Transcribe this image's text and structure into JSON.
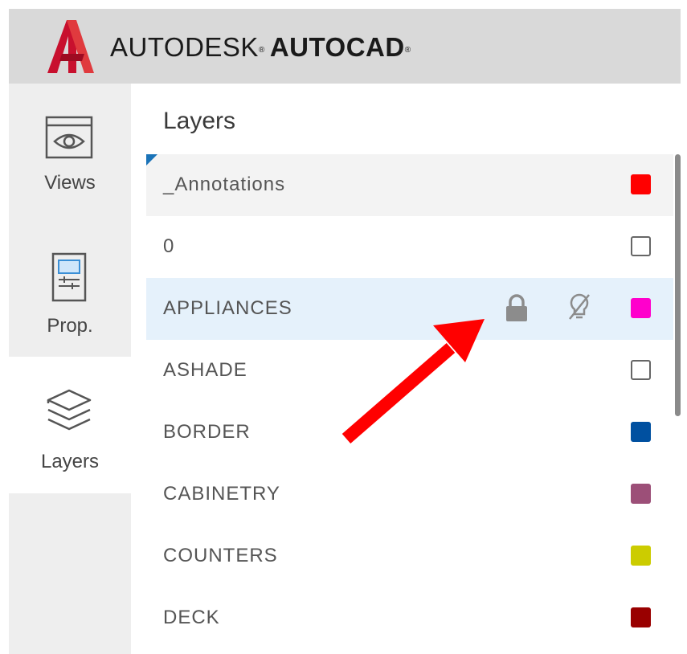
{
  "header": {
    "brand_light": "AUTODESK",
    "brand_bold": "AUTOCAD",
    "registered_mark": "®",
    "logo_icon": "autocad-a-logo-icon",
    "logo_color": "#c8102e"
  },
  "rail": {
    "items": [
      {
        "label": "Views",
        "icon": "eye-window-icon",
        "active": false
      },
      {
        "label": "Prop.",
        "icon": "properties-panel-icon",
        "active": false
      },
      {
        "label": "Layers",
        "icon": "layers-stack-icon",
        "active": true
      }
    ]
  },
  "panel": {
    "title": "Layers"
  },
  "layers": [
    {
      "name": "_Annotations",
      "color": "#ff0000",
      "state": "selected"
    },
    {
      "name": "0",
      "color": "#ffffff",
      "state": "normal"
    },
    {
      "name": "APPLIANCES",
      "color": "#ff00cc",
      "state": "hover",
      "icons": [
        "lock-icon",
        "bulb-off-icon"
      ]
    },
    {
      "name": "ASHADE",
      "color": "#ffffff",
      "state": "normal"
    },
    {
      "name": "BORDER",
      "color": "#0050a0",
      "state": "normal"
    },
    {
      "name": "CABINETRY",
      "color": "#9c4f78",
      "state": "normal"
    },
    {
      "name": "COUNTERS",
      "color": "#cccc00",
      "state": "normal"
    },
    {
      "name": "DECK",
      "color": "#990000",
      "state": "normal"
    }
  ],
  "colors": {
    "accent": "#1a73b8",
    "hover_row": "#e5f1fb",
    "selected_row": "#f3f3f3",
    "annotation_arrow": "#ff0000"
  }
}
